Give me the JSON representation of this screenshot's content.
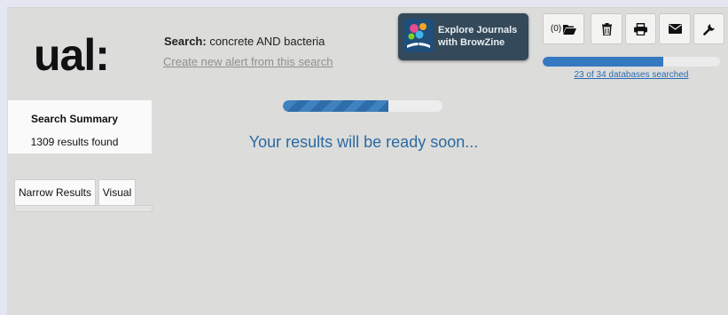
{
  "logo": {
    "text": "ual:"
  },
  "search": {
    "label": "Search:",
    "query": "concrete AND bacteria",
    "alert_link": "Create new alert from this search"
  },
  "browzine": {
    "line1": "Explore Journals",
    "line2": "with BrowZine"
  },
  "toolbar": {
    "folder_count": "(0)",
    "icons": [
      "folder-open-icon",
      "trash-icon",
      "print-icon",
      "envelope-icon",
      "wrench-icon"
    ]
  },
  "databases": {
    "progress_fraction": 0.68,
    "text": "23 of 34 databases searched"
  },
  "summary": {
    "title": "Search Summary",
    "count": "1309 results found"
  },
  "results": {
    "progress_fraction": 0.66,
    "message": "Your results will be ready soon..."
  },
  "tabs": [
    {
      "label": "Narrow Results"
    },
    {
      "label": "Visual"
    }
  ],
  "colors": {
    "accent_blue": "#2b6aa3",
    "link_blue": "#2a6bb5",
    "browzine_bg": "#34495a",
    "page_bg": "#dcdcda"
  }
}
